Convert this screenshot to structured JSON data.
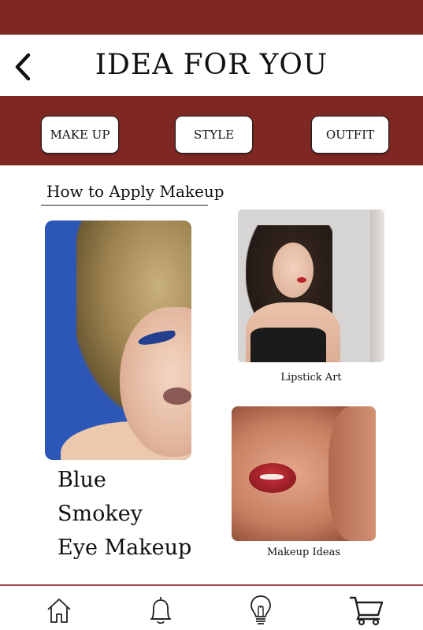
{
  "header": {
    "title": "IDEA FOR YOU"
  },
  "tabs": [
    {
      "label": "MAKE UP"
    },
    {
      "label": "STYLE"
    },
    {
      "label": "OUTFIT"
    }
  ],
  "section": {
    "title": "How to Apply Makeup"
  },
  "featured": {
    "title_lines": [
      "Blue",
      "Smokey",
      "Eye Makeup"
    ]
  },
  "cards": [
    {
      "caption": "Lipstick Art"
    },
    {
      "caption": "Makeup Ideas"
    }
  ],
  "nav": {
    "icons": [
      "home-icon",
      "bell-icon",
      "lightbulb-icon",
      "cart-icon"
    ]
  },
  "colors": {
    "brand": "#7e2723",
    "divider": "#a7494c",
    "background": "#ffffff"
  }
}
